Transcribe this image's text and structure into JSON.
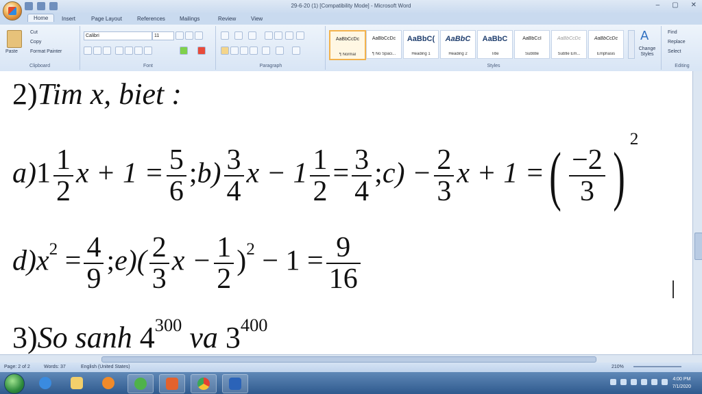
{
  "window": {
    "title": "29-6-20 (1) [Compatibility Mode] - Microsoft Word",
    "controls": [
      "–",
      "▢",
      "✕"
    ]
  },
  "tabs": [
    "Home",
    "Insert",
    "Page Layout",
    "References",
    "Mailings",
    "Review",
    "View"
  ],
  "clipboard": {
    "paste": "Paste",
    "cut": "Cut",
    "copy": "Copy",
    "format_painter": "Format Painter",
    "label": "Clipboard"
  },
  "font": {
    "name": "Calibri",
    "size": "11",
    "label": "Font"
  },
  "paragraph": {
    "label": "Paragraph"
  },
  "styles": {
    "label": "Styles",
    "tiles": [
      {
        "preview": "AaBbCcDc",
        "name": "¶ Normal"
      },
      {
        "preview": "AaBbCcDc",
        "name": "¶ No Spaci..."
      },
      {
        "preview": "AaBbC(",
        "name": "Heading 1"
      },
      {
        "preview": "AaBbC",
        "name": "Heading 2"
      },
      {
        "preview": "AaBbC",
        "name": "Title"
      },
      {
        "preview": "AaBbCcI",
        "name": "Subtitle"
      },
      {
        "preview": "AaBbCcDc",
        "name": "Subtle Em..."
      },
      {
        "preview": "AaBbCcDc",
        "name": "Emphasis"
      }
    ],
    "change": "Change Styles"
  },
  "editing": {
    "find": "Find",
    "replace": "Replace",
    "select": "Select",
    "label": "Editing"
  },
  "document": {
    "line1": {
      "prefix": "2)",
      "text": "Tim x, biet :"
    },
    "a": {
      "label": "a)",
      "whole": "1",
      "n1": "1",
      "d1": "2",
      "mid": "x + 1 =",
      "n2": "5",
      "d2": "6",
      "end": ";"
    },
    "b": {
      "label": "b)",
      "n1": "3",
      "d1": "4",
      "mid": "x − 1",
      "n2": "1",
      "d2": "2",
      "eq": "=",
      "n3": "3",
      "d3": "4",
      "end": ";"
    },
    "c": {
      "label": "c) −",
      "n1": "2",
      "d1": "3",
      "mid": "x + 1 =",
      "n2": "−2",
      "d2": "3",
      "exp": "2"
    },
    "d": {
      "label": "d)",
      "var": "x",
      "exp": "2",
      "eq": "=",
      "n1": "4",
      "d1": "9",
      "end": ";"
    },
    "e": {
      "label": "e)(",
      "n1": "2",
      "d1": "3",
      "mid": "x −",
      "n2": "1",
      "d2": "2",
      "close": ")",
      "exp": "2",
      "tail": "− 1 =",
      "n3": "9",
      "d3": "16"
    },
    "line3": {
      "prefix": "3)",
      "text1": "So sanh",
      "base1": "4",
      "exp1": "300",
      "text2": "va",
      "base2": "3",
      "exp2": "400"
    }
  },
  "status": {
    "page": "Page: 2 of 2",
    "words": "Words: 37",
    "language": "English (United States)",
    "zoom": "210%"
  },
  "clock": {
    "time": "4:00 PM",
    "date": "7/1/2020"
  }
}
